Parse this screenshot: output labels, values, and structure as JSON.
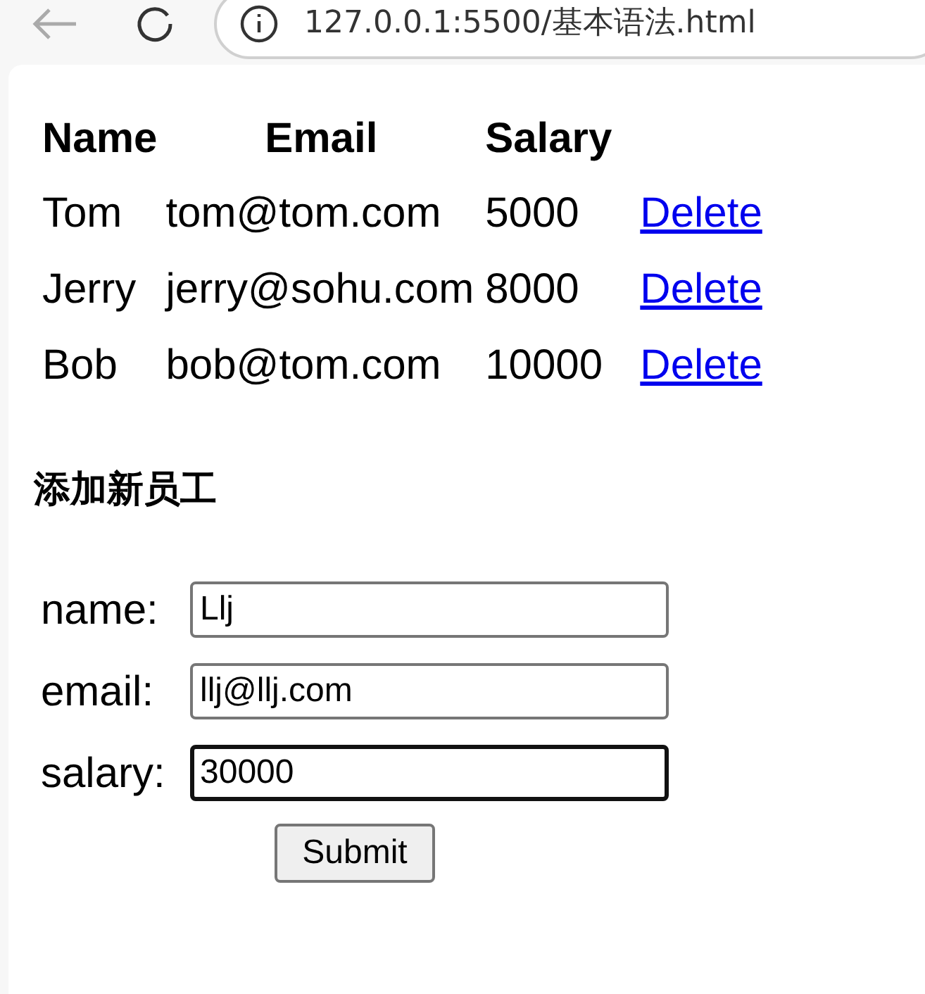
{
  "browser": {
    "address": "127.0.0.1:5500/基本语法.html"
  },
  "table": {
    "columns": [
      "Name",
      "Email",
      "Salary"
    ],
    "rows": [
      {
        "cells": [
          "Tom",
          "tom@tom.com",
          "5000"
        ],
        "action": "Delete"
      },
      {
        "cells": [
          "Jerry",
          "jerry@sohu.com",
          "8000"
        ],
        "action": "Delete"
      },
      {
        "cells": [
          "Bob",
          "bob@tom.com",
          "10000"
        ],
        "action": "Delete"
      }
    ]
  },
  "form": {
    "heading": "添加新员工",
    "fields": [
      {
        "label": "name:",
        "value": "Llj",
        "focused": false
      },
      {
        "label": "email:",
        "value": "llj@llj.com",
        "focused": false
      },
      {
        "label": "salary:",
        "value": "30000",
        "focused": true
      }
    ],
    "submit": "Submit"
  }
}
